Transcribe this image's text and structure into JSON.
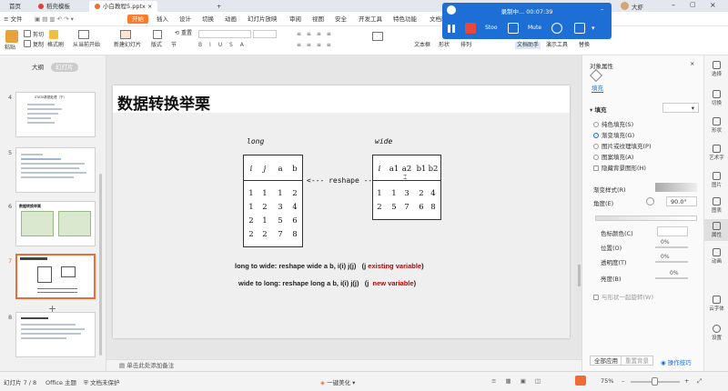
{
  "tabs": [
    {
      "label": "首页",
      "active": false
    },
    {
      "label": "稻壳模板",
      "active": false
    },
    {
      "label": "小白教程5.pptx",
      "active": true
    },
    {
      "label": "+",
      "active": false
    }
  ],
  "menu": {
    "file": "文件",
    "items": [
      "开始",
      "插入",
      "设计",
      "切换",
      "动画",
      "幻灯片放映",
      "审阅",
      "视图",
      "安全",
      "开发工具",
      "特色功能",
      "文档助手"
    ],
    "active": "开始"
  },
  "ribbon": {
    "paste": "粘贴",
    "cut": "剪切",
    "copy": "复制",
    "format_painter": "格式刷",
    "from_current": "从当前开始",
    "new_slide": "新建幻灯片",
    "layout": "版式",
    "section": "节",
    "reset": "重置",
    "textbox": "文本框",
    "shape": "形状",
    "arrange": "排列",
    "doc_assistant": "文档助手",
    "presenter": "演示工具",
    "replace": "替换"
  },
  "recorder": {
    "status": "录制中...",
    "time": "00:07:39",
    "stop_label": "Stoo",
    "mute_label": "Mute"
  },
  "left_panel": {
    "tab_outline": "大纲",
    "tab_slides": "幻灯片",
    "slide_numbers": [
      "4",
      "5",
      "6",
      "7",
      "8"
    ],
    "selected": "7",
    "thumb4_title": "STATA数据处理（下）",
    "thumb6_title": "数据转换举栗"
  },
  "slide": {
    "title": "数据转换举栗",
    "long_label": "long",
    "wide_label": "wide",
    "long_headers": [
      "i",
      "j",
      "a",
      "b"
    ],
    "long_rows": [
      [
        "1",
        "1",
        "1",
        "2"
      ],
      [
        "1",
        "2",
        "3",
        "4"
      ],
      [
        "2",
        "1",
        "5",
        "6"
      ],
      [
        "2",
        "2",
        "7",
        "8"
      ]
    ],
    "wide_headers": [
      "i",
      "a1",
      "a2",
      "b1",
      "b2"
    ],
    "wide_rows": [
      [
        "1",
        "1",
        "3",
        "2",
        "4"
      ],
      [
        "2",
        "5",
        "7",
        "6",
        "8"
      ]
    ],
    "reshape_label": "<--- reshape --->",
    "sentence1": "long to wide: reshape wide a b, i(i) j(j)",
    "sentence1_note_open": "(j",
    "sentence1_note_red": "existing variable",
    "sentence1_note_close": ")",
    "sentence2": "wide to long: reshape long a b, i(i) j(j)",
    "sentence2_note_open": "(j",
    "sentence2_note_red": "new   variable",
    "sentence2_note_close": ")"
  },
  "notes_placeholder": "单击此处添加备注",
  "right_panel": {
    "title": "对象属性",
    "fill_section": "填充",
    "fill_tab": "填充",
    "fill_dropdown": "▾",
    "options": [
      "纯色填充(S)",
      "渐变填充(G)",
      "图片或纹理填充(P)",
      "图案填充(A)",
      "隐藏背景图形(H)"
    ],
    "selected_option": "渐变填充(G)",
    "gradient_style": "渐变样式(R)",
    "angle_label": "角度(E)",
    "angle_value": "90.0°",
    "color_label": "色标颜色(C)",
    "position_label": "位置(O)",
    "position_value": "0%",
    "transparency_label": "透明度(T)",
    "transparency_value": "0%",
    "brightness_label": "亮度(B)",
    "brightness_value": "0%",
    "rotate_label": "与形状一起旋转(W)",
    "apply_all": "全部应用",
    "reset_bg": "重置背景",
    "hint": "操作技巧"
  },
  "side_icons": [
    "选择",
    "切换",
    "形状",
    "艺术字",
    "图片",
    "图表",
    "属性",
    "动画",
    "云字体",
    "设置"
  ],
  "status": {
    "slide_info": "幻灯片 7 / 8",
    "theme": "Office 主题",
    "protect": "文档未保护",
    "beautify": "一键美化",
    "zoom": "75%"
  },
  "colors": {
    "accent": "#ff7a29",
    "recorder": "#1d6fd6",
    "highlight_red": "#c00000",
    "selection": "#f06a3a"
  }
}
